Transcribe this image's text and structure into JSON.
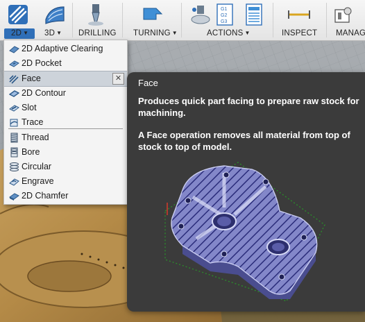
{
  "toolbar": {
    "tabs": [
      {
        "label": "2D",
        "active": true
      },
      {
        "label": "3D"
      },
      {
        "label": "DRILLING"
      },
      {
        "label": "TURNING"
      },
      {
        "label": "ACTIONS"
      },
      {
        "label": "INSPECT"
      },
      {
        "label": "MANAG"
      }
    ],
    "icons": [
      "2d-strategies-icon",
      "3d-strategies-icon",
      "drill-icon",
      "turning-icon",
      "simulate-icon",
      "nc-program-icon",
      "setup-sheet-icon",
      "measure-icon",
      "manage-icon"
    ],
    "accent_color": "#2f6fb8"
  },
  "menu": {
    "items": [
      {
        "label": "2D Adaptive Clearing",
        "icon": "adaptive-clearing-icon"
      },
      {
        "label": "2D Pocket",
        "icon": "pocket-icon"
      },
      {
        "label": "Face",
        "icon": "face-icon",
        "selected": true
      },
      {
        "label": "2D Contour",
        "icon": "contour-icon"
      },
      {
        "label": "Slot",
        "icon": "slot-icon"
      },
      {
        "label": "Trace",
        "icon": "trace-icon"
      },
      {
        "label": "Thread",
        "icon": "thread-icon"
      },
      {
        "label": "Bore",
        "icon": "bore-icon"
      },
      {
        "label": "Circular",
        "icon": "circular-icon"
      },
      {
        "label": "Engrave",
        "icon": "engrave-icon"
      },
      {
        "label": "2D Chamfer",
        "icon": "chamfer-icon"
      }
    ],
    "pin_glyph": "✕"
  },
  "tooltip": {
    "title": "Face",
    "description": "Produces quick part facing to prepare raw stock for machining.",
    "detail": "A Face operation removes all material from top of stock to top of model."
  }
}
